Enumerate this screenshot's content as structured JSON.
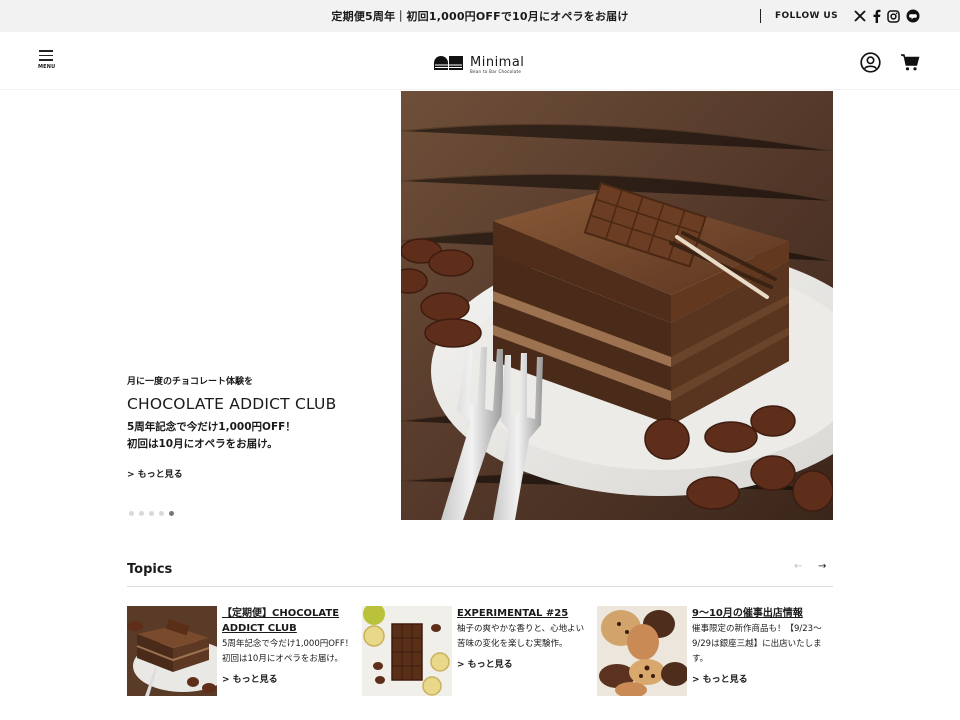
{
  "announcement": {
    "text": "定期便5周年｜初回1,000円OFFで10月にオペラをお届け",
    "follow_label": "FOLLOW US",
    "social_icons": [
      "x-icon",
      "facebook-icon",
      "instagram-icon",
      "line-icon"
    ]
  },
  "header": {
    "menu_label": "MENU",
    "logo_text": "Minimal",
    "logo_sub": "Bean to Bar Chocolate",
    "icons": [
      "user-icon",
      "cart-icon"
    ]
  },
  "hero": {
    "kicker": "月に一度のチョコレート体験を",
    "title": "CHOCOLATE ADDICT CLUB",
    "desc_line1": "5周年記念で今だけ1,000円OFF！",
    "desc_line2": "初回は10月にオペラをお届け。",
    "more": "> もっと見る",
    "slides_count": 5,
    "active_slide": 5
  },
  "topics": {
    "title": "Topics",
    "prev": "←",
    "next": "→",
    "items": [
      {
        "title": "【定期便】CHOCOLATE ADDICT CLUB",
        "text": "5周年記念で今だけ1,000円OFF！初回は10月にオペラをお届け。",
        "more": "> もっと見る"
      },
      {
        "title": "EXPERIMENTAL #25",
        "text": "柚子の爽やかな香りと、心地よい苦味の変化を楽しむ実験作。",
        "more": "> もっと見る"
      },
      {
        "title": "9〜10月の催事出店情報",
        "text": "催事限定の新作商品も！【9/23〜9/29は銀座三越】に出店いたします。",
        "more": "> もっと見る"
      }
    ]
  },
  "colors": {
    "announce_bg": "#f2f2f2",
    "text": "#1a1a1a",
    "chocolate": "#5a3520",
    "wood": "#5b3f2b"
  }
}
